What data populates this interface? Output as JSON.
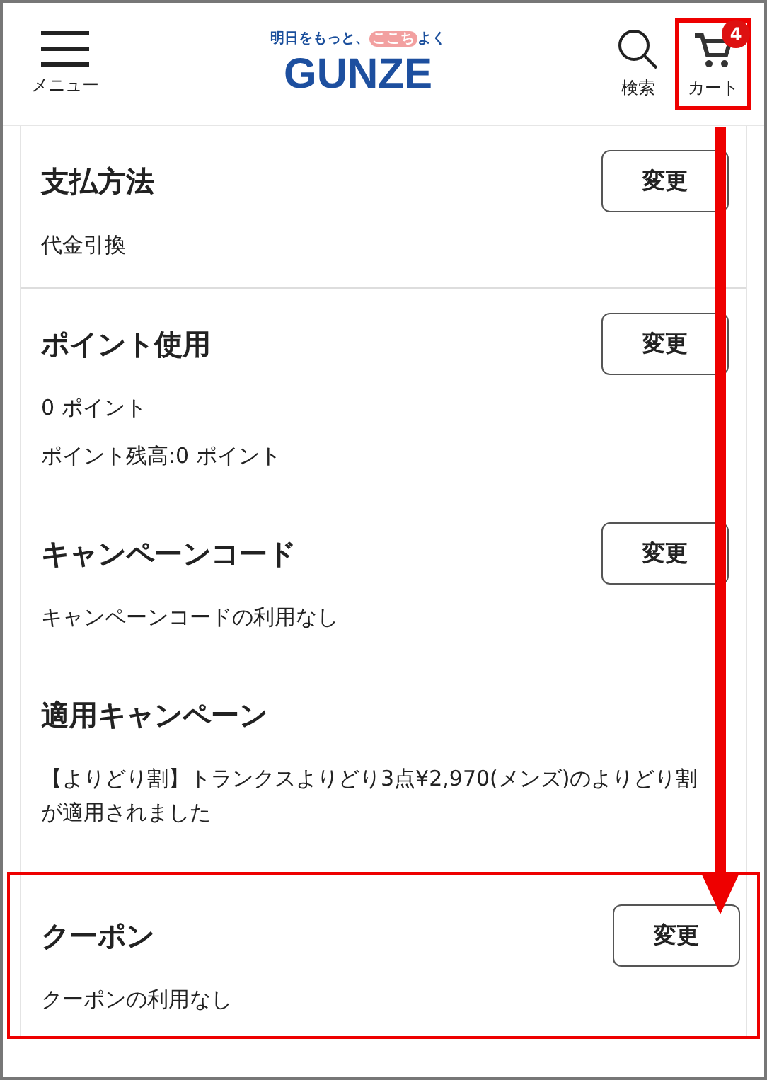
{
  "header": {
    "menu_label": "メニュー",
    "logo_tagline_before": "明日をもっと、",
    "logo_tagline_highlight": "ここち",
    "logo_tagline_after": "よく",
    "logo": "GUNZE",
    "search_label": "検索",
    "cart_label": "カート",
    "cart_count": "4",
    "cart_highlighted": true
  },
  "sections": [
    {
      "title": "支払方法",
      "button": "変更",
      "lines": [
        "代金引換"
      ],
      "divider_after": true,
      "highlighted": false
    },
    {
      "title": "ポイント使用",
      "button": "変更",
      "lines": [
        "0 ポイント",
        "ポイント残高:0 ポイント"
      ],
      "divider_after": false,
      "highlighted": false
    },
    {
      "title": "キャンペーンコード",
      "button": "変更",
      "lines": [
        "キャンペーンコードの利用なし"
      ],
      "divider_after": false,
      "highlighted": false
    },
    {
      "title": "適用キャンペーン",
      "lines": [
        "【よりどり割】トランクスよりどり3点¥2,970(メンズ)のよりどり割が適用されました"
      ],
      "divider_after": false,
      "highlighted": false
    },
    {
      "title": "クーポン",
      "button": "変更",
      "lines": [
        "クーポンの利用なし"
      ],
      "divider_after": false,
      "highlighted": true
    }
  ],
  "annotation": {
    "arrow": true
  }
}
